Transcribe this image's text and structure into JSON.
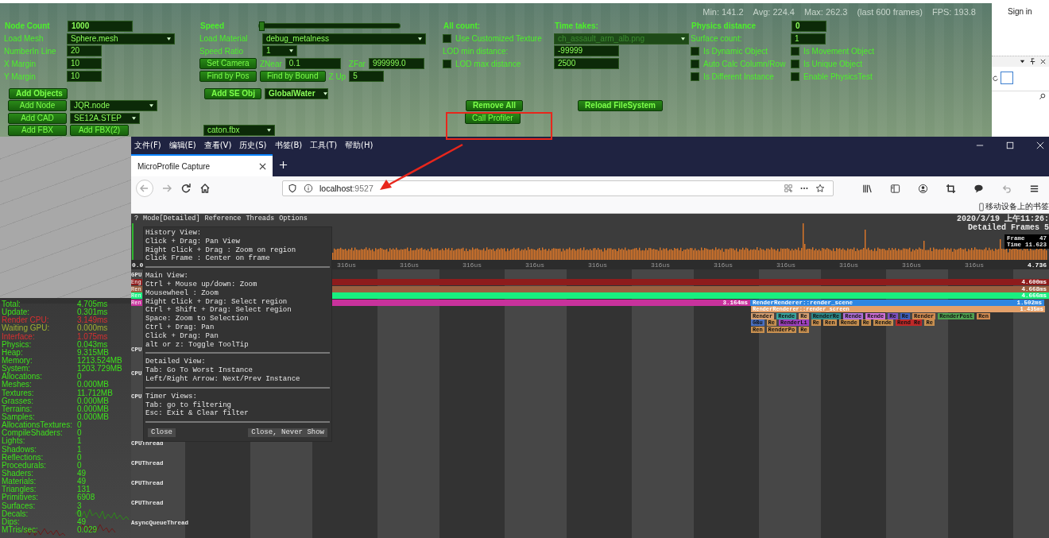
{
  "scene": {
    "fps_stats": [
      "Min: 141.2",
      "Avg: 224.4",
      "Max: 262.3",
      "(last 600 frames)",
      "FPS: 193.8"
    ],
    "top_columns": [
      [
        [
          {
            "kind": "label",
            "text": "Node Count"
          },
          {
            "kind": "field",
            "value": "1000"
          }
        ],
        [
          {
            "kind": "label",
            "text": "Load Mesh"
          },
          {
            "kind": "dropdown",
            "value": "Sphere.mesh",
            "disabled": false
          }
        ],
        [
          {
            "kind": "label",
            "text": "NumberIn Line"
          },
          {
            "kind": "field",
            "value": "20"
          }
        ],
        [
          {
            "kind": "label",
            "text": "X Margin"
          },
          {
            "kind": "field",
            "value": "10"
          }
        ],
        [
          {
            "kind": "label",
            "text": "Y Margin"
          },
          {
            "kind": "field",
            "value": "10"
          }
        ]
      ],
      [
        [
          {
            "kind": "label",
            "text": "Speed"
          },
          {
            "kind": "slider",
            "level": 0.0
          }
        ],
        [
          {
            "kind": "label",
            "text": "Load Material"
          },
          {
            "kind": "dropdown",
            "value": "debug_metalness",
            "disabled": false
          }
        ],
        [
          {
            "kind": "label",
            "text": "Speed Ratio"
          },
          {
            "kind": "dropdown",
            "value": "1",
            "disabled": false
          }
        ],
        [
          {
            "kind": "button",
            "text": "Set Camera"
          },
          {
            "kind": "label",
            "text": "ZNear"
          },
          {
            "kind": "field",
            "value": "0.1"
          },
          {
            "kind": "label",
            "text": "ZFar"
          },
          {
            "kind": "field",
            "value": "999999.0"
          }
        ],
        [
          {
            "kind": "button",
            "text": "Find by Pos"
          },
          {
            "kind": "button",
            "text": "Find by Bound"
          },
          {
            "kind": "label",
            "text": "Z Up"
          },
          {
            "kind": "field",
            "value": "5"
          }
        ]
      ],
      [
        [
          {
            "kind": "label",
            "text": "All count:"
          }
        ],
        [
          {
            "kind": "checkbox",
            "text": "Use Customized Texture",
            "checked": false
          }
        ],
        [
          {
            "kind": "label",
            "text": "LOD min distance:"
          }
        ],
        [
          {
            "kind": "checkbox",
            "text": "LOD max distance",
            "checked": false
          }
        ]
      ],
      [
        [
          {
            "kind": "label",
            "text": "Time takes:"
          }
        ],
        [
          {
            "kind": "dropdown",
            "value": "ch_assault_arm_alb.png",
            "disabled": true
          }
        ],
        [
          {
            "kind": "field",
            "value": "-99999"
          }
        ],
        [
          {
            "kind": "field",
            "value": "2500"
          }
        ]
      ],
      [
        [
          {
            "kind": "label",
            "text": "Physics distance"
          }
        ],
        [
          {
            "kind": "label",
            "text": "Surface count:"
          }
        ],
        [
          {
            "kind": "checkbox",
            "text": "Is Dynamic Object",
            "checked": false
          }
        ],
        [
          {
            "kind": "checkbox",
            "text": "Auto Calc Column/Row",
            "checked": false
          }
        ],
        [
          {
            "kind": "checkbox",
            "text": "Is Different Instance",
            "checked": false
          }
        ]
      ],
      [
        [
          {
            "kind": "field",
            "value": "0"
          }
        ],
        [
          {
            "kind": "field",
            "value": "1"
          }
        ],
        [
          {
            "kind": "checkbox",
            "text": "Is Movement Object",
            "checked": false
          }
        ],
        [
          {
            "kind": "checkbox",
            "text": "Is Unique Object",
            "checked": false
          }
        ],
        [
          {
            "kind": "checkbox",
            "text": "Enable PhysicsTest",
            "checked": false
          }
        ]
      ]
    ],
    "bottom_columns": [
      [
        [
          {
            "kind": "button",
            "text": "Add Objects"
          }
        ],
        [
          {
            "kind": "button",
            "text": "Add Node"
          },
          {
            "kind": "dropdown",
            "value": "JQR.node",
            "disabled": false
          }
        ],
        [
          {
            "kind": "button",
            "text": "Add CAD"
          },
          {
            "kind": "dropdown",
            "value": "SE12A.STEP",
            "disabled": false
          }
        ],
        [
          {
            "kind": "button",
            "text": "Add FBX"
          },
          {
            "kind": "button",
            "text": "Add FBX(2)"
          }
        ]
      ],
      [
        [
          {
            "kind": "button",
            "text": "Add SE Obj"
          },
          {
            "kind": "dropdown",
            "value": "GlobalWater",
            "disabled": false
          }
        ],
        [
          {
            "kind": "dropdown",
            "value": "caton.fbx",
            "disabled": false
          }
        ]
      ],
      [
        [
          {
            "kind": "button",
            "text": "Remove All"
          },
          {
            "kind": "button",
            "text": "Reload FileSystem"
          }
        ],
        [
          {
            "kind": "button",
            "text": "Call Profiler"
          }
        ]
      ]
    ]
  },
  "side_panel": {
    "sign_in": "Sign in"
  },
  "stats": [
    {
      "label": "Total:",
      "value": "4.705ms",
      "kind": "normal"
    },
    {
      "label": "Update:",
      "value": "0.301ms",
      "kind": "normal"
    },
    {
      "label": "Render CPU:",
      "value": "3.149ms",
      "kind": "alert"
    },
    {
      "label": "Waiting GPU:",
      "value": "0.000ms",
      "kind": "idle"
    },
    {
      "label": "Interface:",
      "value": "1.075ms",
      "kind": "alert"
    },
    {
      "label": "Physics:",
      "value": "0.043ms",
      "kind": "normal"
    },
    {
      "label": "Heap:",
      "value": "9.315MB",
      "kind": "normal"
    },
    {
      "label": "Memory:",
      "value": "1213.524MB",
      "kind": "normal"
    },
    {
      "label": "System:",
      "value": "1203.729MB",
      "kind": "normal"
    },
    {
      "label": "Allocations:",
      "value": "0",
      "kind": "normal"
    },
    {
      "label": "Meshes:",
      "value": "0.000MB",
      "kind": "normal"
    },
    {
      "label": "Textures:",
      "value": "11.712MB",
      "kind": "normal"
    },
    {
      "label": "Grasses:",
      "value": "0.000MB",
      "kind": "normal"
    },
    {
      "label": "Terrains:",
      "value": "0.000MB",
      "kind": "normal"
    },
    {
      "label": "Samples:",
      "value": "0.000MB",
      "kind": "normal"
    },
    {
      "label": "AllocationsTextures:",
      "value": "0",
      "kind": "normal"
    },
    {
      "label": "CompileShaders:",
      "value": "0",
      "kind": "normal"
    },
    {
      "label": "Lights:",
      "value": "1",
      "kind": "normal"
    },
    {
      "label": "Shadows:",
      "value": "1",
      "kind": "normal"
    },
    {
      "label": "Reflections:",
      "value": "0",
      "kind": "normal"
    },
    {
      "label": "Procedurals:",
      "value": "0",
      "kind": "normal"
    },
    {
      "label": "Shaders:",
      "value": "49",
      "kind": "normal"
    },
    {
      "label": "Materials:",
      "value": "49",
      "kind": "normal"
    },
    {
      "label": "Triangles:",
      "value": "131",
      "kind": "normal"
    },
    {
      "label": "Primitives:",
      "value": "6908",
      "kind": "normal"
    },
    {
      "label": "Surfaces:",
      "value": "3",
      "kind": "normal"
    },
    {
      "label": "Decals:",
      "value": "0",
      "kind": "normal"
    },
    {
      "label": "Dips:",
      "value": "49",
      "kind": "normal"
    },
    {
      "label": "MTris/sec:",
      "value": "0.029",
      "kind": "normal"
    }
  ],
  "browser": {
    "menu": [
      "文件(F)",
      "编辑(E)",
      "查看(V)",
      "历史(S)",
      "书签(B)",
      "工具(T)",
      "帮助(H)"
    ],
    "tabs": [
      {
        "title": "MicroProfile Capture",
        "selected": true
      }
    ],
    "url_host": "localhost",
    "url_port": ":9527",
    "bookmark": "移动设备上的书签"
  },
  "profiler": {
    "menu": [
      "?",
      "Mode[Detailed]",
      "Reference",
      "Threads",
      "Options"
    ],
    "date": "2020/3/19 上午11:26:",
    "frames_label": "Detailed Frames 5",
    "frame_info": [
      {
        "label": "Frame",
        "value": "47"
      },
      {
        "label": "Time",
        "value": "11.623"
      }
    ],
    "ruler_start": "0.0",
    "ruler_ticks": [
      "316us",
      "316us",
      "316us",
      "316us",
      "316us",
      "316us",
      "316us",
      "316us",
      "316us",
      "316us",
      "316us"
    ],
    "ruler_end": "4.736",
    "gpu_label": "GPU",
    "bars": [
      {
        "chip": "Eng",
        "segments": [
          {
            "time": "4.600ms",
            "color": "#8e1c1c"
          }
        ]
      },
      {
        "chip": "Ren",
        "segments": [
          {
            "time": "4.668ms",
            "color": "#9a6040"
          }
        ]
      },
      {
        "chip": "Ren",
        "segments": [
          {
            "time": "4.666ms",
            "color": "#18f080"
          }
        ]
      },
      {
        "chip": "Ren",
        "segments": [
          {
            "time": "3.164ms",
            "color": "#c8329c"
          },
          {
            "name": "RenderRenderer::render_scene",
            "time": "1.502ms",
            "color": "#2e86e0"
          }
        ]
      }
    ],
    "block_rows": [
      [
        {
          "name": "RenderRenderer::render_screen",
          "time": "1.435ms",
          "color": "#e3a06a"
        }
      ],
      [
        {
          "name": "Render",
          "color": "#d8a070"
        },
        {
          "name": "Rende",
          "color": "#3aa6a0"
        },
        {
          "name": "Re",
          "color": "#d8a070"
        },
        {
          "name": "RenderRe",
          "color": "#2f8c8c"
        },
        {
          "name": "Rende",
          "color": "#b070d8"
        },
        {
          "name": "Rende",
          "color": "#d070d8"
        },
        {
          "name": "Re",
          "color": "#8050c0"
        },
        {
          "name": "Re",
          "color": "#4060c0"
        },
        {
          "name": "Render",
          "color": "#d08a50"
        },
        {
          "name": "RenderPost",
          "color": "#50a050"
        },
        {
          "name": "Ren",
          "color": "#d08a50"
        }
      ],
      [
        {
          "name": "GBu",
          "color": "#4a70c0"
        },
        {
          "name": "Re",
          "color": "#c89050"
        },
        {
          "name": "RenderLi",
          "color": "#a040c0"
        },
        {
          "name": "Re",
          "color": "#c89050"
        },
        {
          "name": "Ren",
          "color": "#c89050"
        },
        {
          "name": "Rende",
          "color": "#c89050"
        },
        {
          "name": "Re",
          "color": "#c89050"
        },
        {
          "name": "Rende",
          "color": "#c89050"
        },
        {
          "name": "Rend Re",
          "color": "#c02828"
        },
        {
          "name": "Re",
          "color": "#c89050"
        }
      ],
      [
        {
          "name": "Ren",
          "color": "#c89050"
        },
        {
          "name": "RenderPo",
          "color": "#c89050"
        },
        {
          "name": "Re",
          "color": "#c89050"
        }
      ]
    ],
    "threads": [
      "CPU",
      "CPU",
      "CPU",
      "CPUThread",
      "CPUThread",
      "CPUThread",
      "CPUThread",
      "AsyncQueueThread"
    ],
    "help": [
      {
        "title": "History View:",
        "lines": [
          "Click + Drag: Pan View",
          "Right Click + Drag : Zoom on region",
          "Click Frame : Center on frame"
        ]
      },
      {
        "title": "Main View:",
        "lines": [
          "Ctrl + Mouse up/down: Zoom",
          "Mousewheel : Zoom",
          "Right Click + Drag: Select region",
          "Ctrl + Shift + Drag: Select region",
          "Space: Zoom to Selection",
          "Ctrl + Drag: Pan",
          "Click + Drag: Pan",
          "alt or z: Toggle ToolTip"
        ]
      },
      {
        "title": "Detailed View:",
        "lines": [
          "Tab: Go To Worst Instance",
          "Left/Right Arrow: Next/Prev Instance"
        ]
      },
      {
        "title": "Timer Views:",
        "lines": [
          "Tab: go to filtering",
          "Esc: Exit & Clear filter"
        ]
      }
    ],
    "help_buttons": [
      "Close",
      "Close, Never Show"
    ]
  }
}
